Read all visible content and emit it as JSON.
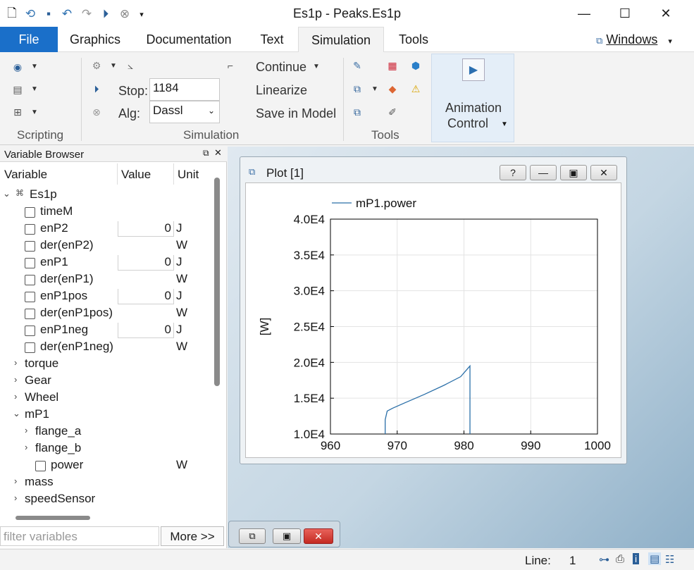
{
  "window": {
    "title": "Es1p - Peaks.Es1p",
    "minimize": "—",
    "maximize": "☐",
    "close": "✕"
  },
  "menu": {
    "tabs": [
      "File",
      "Graphics",
      "Documentation",
      "Text",
      "Simulation",
      "Tools"
    ],
    "windows_label": "Windows"
  },
  "ribbon": {
    "groups": [
      "Scripting",
      "Simulation",
      "Tools"
    ],
    "stop_label": "Stop:",
    "stop_value": "1184",
    "alg_label": "Alg:",
    "alg_value": "Dassl",
    "continue_label": "Continue",
    "linearize_label": "Linearize",
    "save_in_model_label": "Save in Model",
    "animation_label_1": "Animation",
    "animation_label_2": "Control"
  },
  "variable_browser": {
    "title": "Variable Browser",
    "columns": [
      "Variable",
      "Value",
      "Unit"
    ],
    "root": "Es1p",
    "rows": [
      {
        "name": "timeM",
        "value": "",
        "unit": ""
      },
      {
        "name": "enP2",
        "value": "0",
        "unit": "J"
      },
      {
        "name": "der(enP2)",
        "value": "",
        "unit": "W"
      },
      {
        "name": "enP1",
        "value": "0",
        "unit": "J"
      },
      {
        "name": "der(enP1)",
        "value": "",
        "unit": "W"
      },
      {
        "name": "enP1pos",
        "value": "0",
        "unit": "J"
      },
      {
        "name": "der(enP1pos)",
        "value": "",
        "unit": "W"
      },
      {
        "name": "enP1neg",
        "value": "0",
        "unit": "J"
      },
      {
        "name": "der(enP1neg)",
        "value": "",
        "unit": "W"
      }
    ],
    "groups_a": [
      "torque",
      "Gear",
      "Wheel"
    ],
    "mp1": "mP1",
    "mp1_children": [
      "flange_a",
      "flange_b"
    ],
    "power": {
      "name": "power",
      "unit": "W"
    },
    "groups_b": [
      "mass",
      "speedSensor"
    ],
    "filter_placeholder": "filter variables",
    "more_label": "More >>"
  },
  "plot_window": {
    "title": "Plot [1]",
    "help": "?"
  },
  "chart_data": {
    "type": "line",
    "title": "",
    "xlabel": "",
    "ylabel": "[W]",
    "xlim": [
      960,
      1000
    ],
    "ylim": [
      10000,
      40000
    ],
    "xticks": [
      "960",
      "970",
      "980",
      "990",
      "1000"
    ],
    "yticks": [
      "1.0E4",
      "1.5E4",
      "2.0E4",
      "2.5E4",
      "3.0E4",
      "3.5E4",
      "4.0E4"
    ],
    "grid": true,
    "legend_placement": "top-left",
    "series": [
      {
        "name": "mP1.power",
        "color": "#2a6fa8",
        "x": [
          968.2,
          968.2,
          968.5,
          969.3,
          971.0,
          974.0,
          977.0,
          979.5,
          980.9,
          980.9
        ],
        "y": [
          10000,
          12000,
          13200,
          13600,
          14300,
          15500,
          16800,
          18000,
          19500,
          10000
        ]
      }
    ]
  },
  "status": {
    "line_label": "Line:",
    "line_value": "1"
  },
  "colors": {
    "accent": "#1a6fc9",
    "plot_line": "#2a6fa8"
  }
}
